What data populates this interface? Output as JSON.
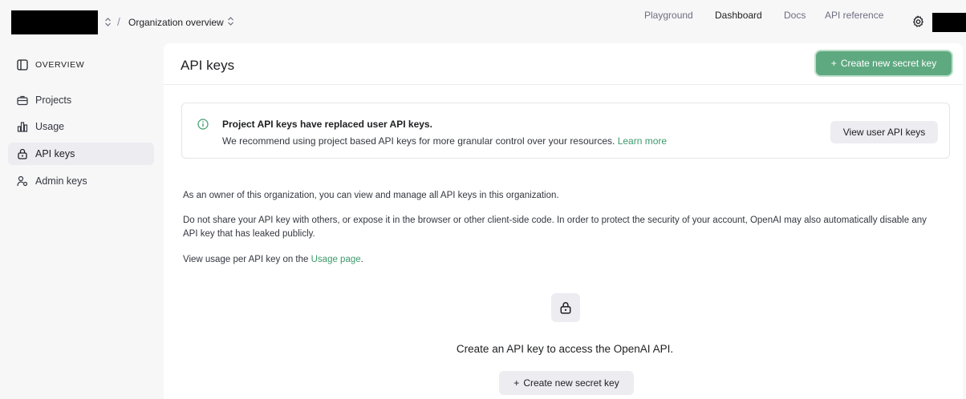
{
  "topbar": {
    "org_chevron": "⌃⌄",
    "separator": "/",
    "project_name": "Organization overview",
    "project_chevron": "⌃⌄",
    "nav": [
      {
        "label": "Playground",
        "active": false
      },
      {
        "label": "Dashboard",
        "active": true
      },
      {
        "label": "Docs",
        "active": false
      },
      {
        "label": "API reference",
        "active": false
      }
    ],
    "settings_icon": "gear-icon"
  },
  "sidebar": {
    "items": [
      {
        "label": "OVERVIEW",
        "icon": "panel-icon",
        "active": false
      },
      {
        "label": "Projects",
        "icon": "briefcase-icon",
        "active": false
      },
      {
        "label": "Usage",
        "icon": "bar-chart-icon",
        "active": false
      },
      {
        "label": "API keys",
        "icon": "lock-icon",
        "active": true
      },
      {
        "label": "Admin keys",
        "icon": "user-key-icon",
        "active": false
      }
    ]
  },
  "main": {
    "title": "API keys",
    "create_button_label": "Create new secret key",
    "notice": {
      "title": "Project API keys have replaced user API keys.",
      "body": "We recommend using project based API keys for more granular control over your resources.",
      "link": "Learn more",
      "button_label": "View user API keys"
    },
    "para1": "As an owner of this organization, you can view and manage all API keys in this organization.",
    "para2": "Do not share your API key with others, or expose it in the browser or other client-side code. In order to protect the security of your account, OpenAI may also automatically disable any API key that has leaked publicly.",
    "para3_prefix": "View usage per API key on the",
    "para3_link": "Usage page",
    "para3_suffix": ".",
    "empty_state": {
      "title": "Create an API key to access the OpenAI API.",
      "button_label": "Create new secret key"
    }
  },
  "colors": {
    "accent_green": "#5fa981",
    "link_green": "#3c9a6a",
    "active_bg": "#ececf1"
  }
}
